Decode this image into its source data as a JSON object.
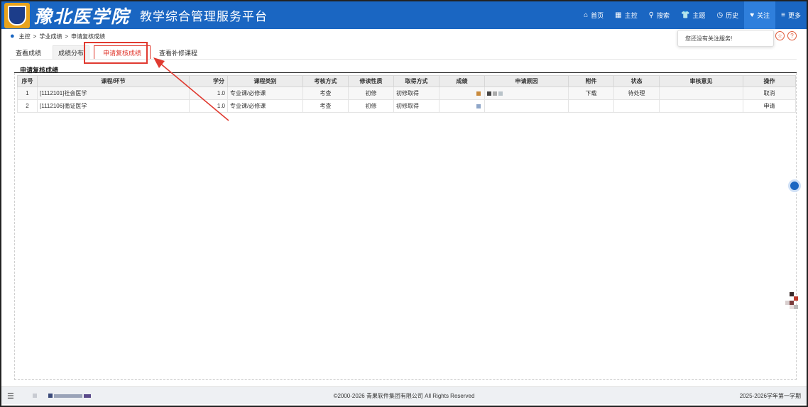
{
  "header": {
    "brand": "豫北医学院",
    "platform": "教学综合管理服务平台",
    "nav": [
      {
        "label": "首页",
        "icon": "home-icon",
        "glyph": "⌂"
      },
      {
        "label": "主控",
        "icon": "grid-icon",
        "glyph": "▦"
      },
      {
        "label": "搜索",
        "icon": "search-icon",
        "glyph": "⚲"
      },
      {
        "label": "主题",
        "icon": "shirt-icon",
        "glyph": "👕"
      },
      {
        "label": "历史",
        "icon": "clock-icon",
        "glyph": "◷"
      },
      {
        "label": "关注",
        "icon": "heart-icon",
        "glyph": "♥"
      },
      {
        "label": "更多",
        "icon": "menu-icon",
        "glyph": "≡"
      }
    ]
  },
  "breadcrumb": [
    "主控",
    ">",
    "学业成绩",
    ">",
    "申请复核成绩"
  ],
  "popup": {
    "text": "您还没有关注服务!"
  },
  "tabs": [
    {
      "label": "查看成绩",
      "active": false
    },
    {
      "label": "成绩分布",
      "active": false
    },
    {
      "label": "申请复核成绩",
      "active": true
    },
    {
      "label": "查看补修课程",
      "active": false
    }
  ],
  "section": {
    "title": "申请复核成绩"
  },
  "table": {
    "columns": [
      "序号",
      "课程/环节",
      "学分",
      "课程类别",
      "考核方式",
      "修读性质",
      "取得方式",
      "成绩",
      "申请原因",
      "附件",
      "状态",
      "审核意见",
      "操作"
    ],
    "rows": [
      {
        "index": "1",
        "course": "[1112101]社会医学",
        "credit": "1.0",
        "category": "专业课/必修课",
        "exam": "考查",
        "nature": "初修",
        "method": "初修取得",
        "score": "",
        "reason": "",
        "attachment": "下载",
        "status": "待处理",
        "opinion": "",
        "action": "取消"
      },
      {
        "index": "2",
        "course": "[1112106]循证医学",
        "credit": "1.0",
        "category": "专业课/必修课",
        "exam": "考查",
        "nature": "初修",
        "method": "初修取得",
        "score": "",
        "reason": "",
        "attachment": "",
        "status": "",
        "opinion": "",
        "action": "申请"
      }
    ]
  },
  "footer": {
    "copyright": "©2000-2026 青果软件集团有限公司 All Rights Reserved",
    "term": "2025-2026学年第一学期"
  },
  "colors": {
    "header": "#1a66c2",
    "accent": "#e0342a",
    "link": "#1a66c2"
  }
}
